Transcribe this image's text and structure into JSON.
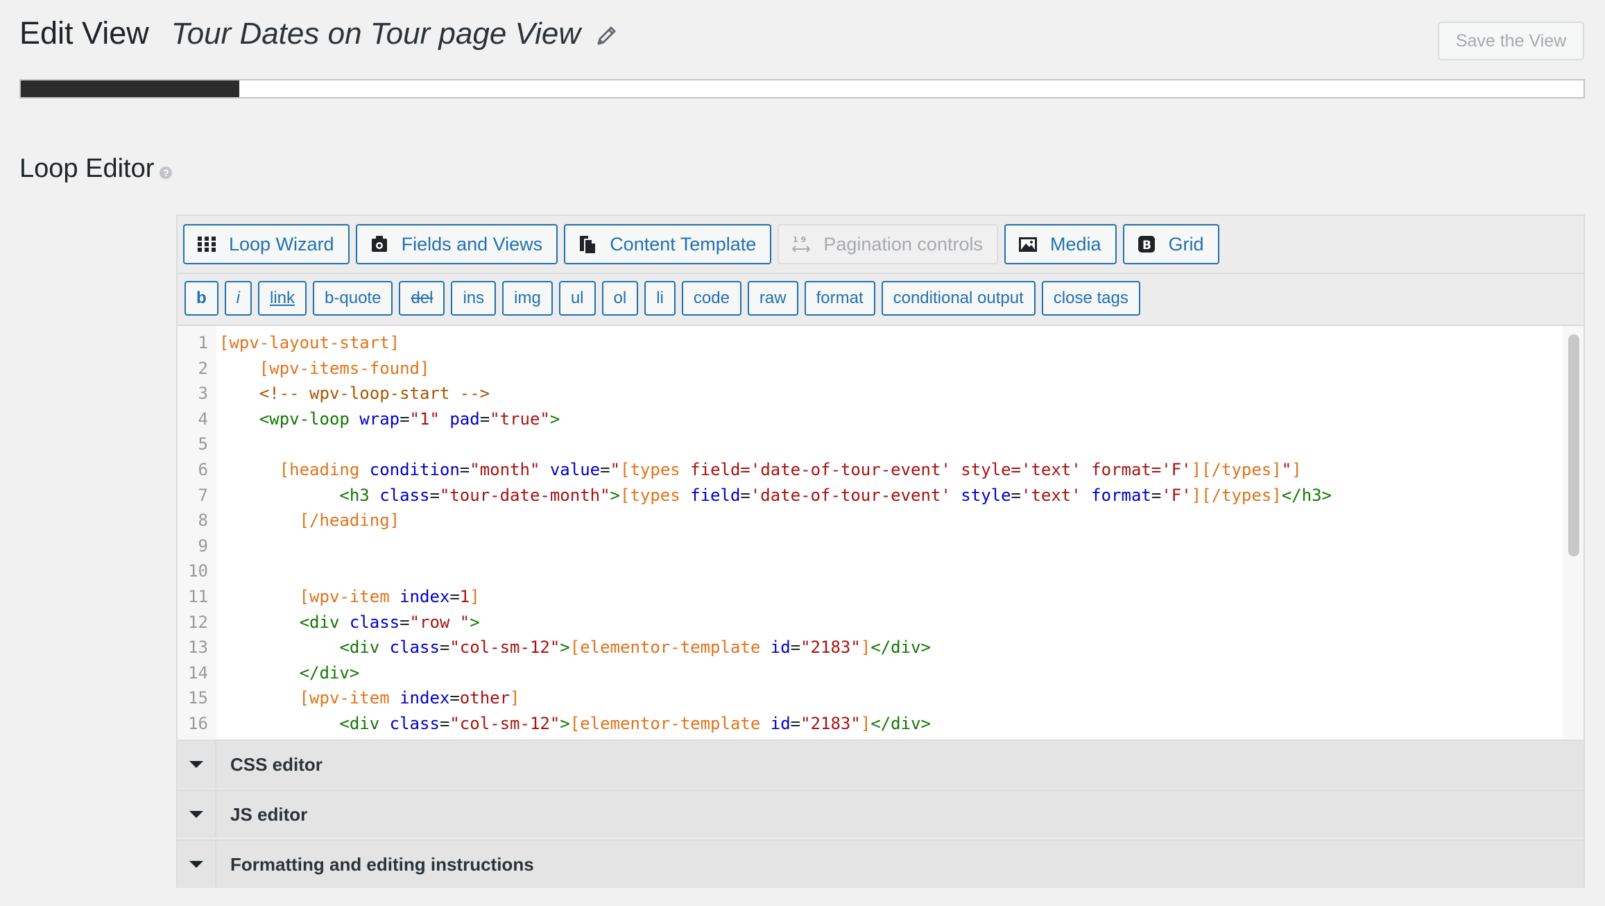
{
  "header": {
    "title": "Edit View",
    "view_name": "Tour Dates on Tour page View",
    "save_label": "Save the View"
  },
  "progress": {
    "fraction": 0.14
  },
  "section": {
    "title": "Loop Editor"
  },
  "toolbar": {
    "main_buttons": [
      {
        "label": "Loop Wizard",
        "icon": "grid-dots-icon"
      },
      {
        "label": "Fields and Views",
        "icon": "camera-icon"
      },
      {
        "label": "Content Template",
        "icon": "copy-document-icon"
      },
      {
        "label": "Pagination controls",
        "icon": "pagination-icon",
        "disabled": true
      },
      {
        "label": "Media",
        "icon": "image-icon"
      },
      {
        "label": "Grid",
        "icon": "bootstrap-icon"
      }
    ],
    "quicktags": [
      "b",
      "i",
      "link",
      "b-quote",
      "del",
      "ins",
      "img",
      "ul",
      "ol",
      "li",
      "code",
      "raw",
      "format",
      "conditional output",
      "close tags"
    ]
  },
  "code": {
    "line_numbers": [
      "1",
      "2",
      "3",
      "4",
      "5",
      "6",
      "7",
      "8",
      "9",
      "10",
      "11",
      "12",
      "13",
      "14",
      "15",
      "16"
    ]
  },
  "panels": {
    "css": "CSS editor",
    "js": "JS editor",
    "formatting": "Formatting and editing instructions"
  },
  "colors": {
    "accent": "#2271b1",
    "shortcode": "#e0731c",
    "tag": "#117700",
    "attribute": "#0000cc",
    "string": "#aa1111"
  }
}
